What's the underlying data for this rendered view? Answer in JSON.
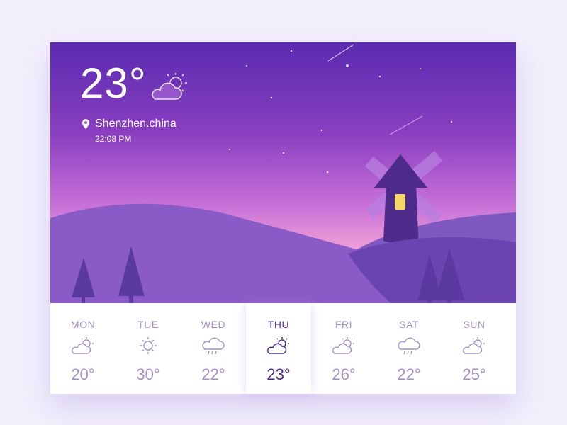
{
  "current": {
    "temperature": "23°",
    "condition_icon": "partly-cloudy-icon",
    "location": "Shenzhen.china",
    "time": "22:08 PM"
  },
  "forecast": [
    {
      "day": "MON",
      "icon": "partly-cloudy-icon",
      "temp": "20°"
    },
    {
      "day": "TUE",
      "icon": "sun-icon",
      "temp": "30°"
    },
    {
      "day": "WED",
      "icon": "rain-cloud-icon",
      "temp": "22°"
    },
    {
      "day": "THU",
      "icon": "partly-cloudy-icon",
      "temp": "23°",
      "selected": true
    },
    {
      "day": "FRI",
      "icon": "partly-cloudy-icon",
      "temp": "26°"
    },
    {
      "day": "SAT",
      "icon": "rain-cloud-icon",
      "temp": "22°"
    },
    {
      "day": "SUN",
      "icon": "partly-cloudy-icon",
      "temp": "25°"
    }
  ],
  "colors": {
    "sky_top": "#5a2bb0",
    "sky_bottom": "#f8b6cf",
    "hills": "#8a5ac6",
    "text_inactive": "#a491c9",
    "text_active": "#4a2a86"
  }
}
